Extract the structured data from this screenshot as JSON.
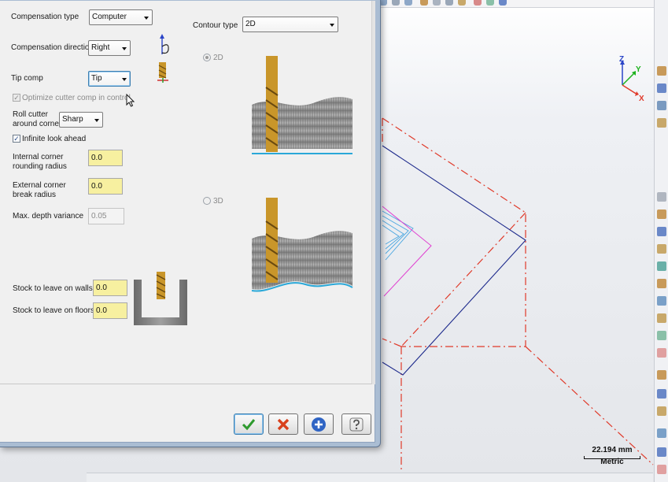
{
  "dialog": {
    "compensation_type": {
      "label": "Compensation type",
      "value": "Computer"
    },
    "compensation_direction": {
      "label": "Compensation direction",
      "value": "Right"
    },
    "tip_comp": {
      "label": "Tip comp",
      "value": "Tip"
    },
    "optimize_cutter_comp": {
      "label": "Optimize cutter comp in control",
      "checked": true,
      "enabled": false
    },
    "roll_cutter": {
      "label_line1": "Roll cutter",
      "label_line2": "around corners",
      "value": "Sharp"
    },
    "infinite_look_ahead": {
      "label": "Infinite look ahead",
      "checked": true
    },
    "internal_corner": {
      "label_line1": "Internal corner",
      "label_line2": "rounding radius",
      "value": "0.0"
    },
    "external_corner": {
      "label_line1": "External corner",
      "label_line2": "break radius",
      "value": "0.0"
    },
    "max_depth_variance": {
      "label": "Max. depth variance",
      "value": "0.05"
    },
    "stock_walls": {
      "label": "Stock to leave on walls",
      "value": "0.0"
    },
    "stock_floors": {
      "label": "Stock to leave on floors",
      "value": "0.0"
    },
    "contour_type": {
      "label": "Contour type",
      "value": "2D"
    },
    "option_2d": {
      "label": "2D",
      "selected": true
    },
    "option_3d": {
      "label": "3D",
      "selected": false
    },
    "buttons": {
      "ok": {
        "icon": "checkmark-icon",
        "color": "#2e9a2e"
      },
      "cancel": {
        "icon": "x-icon",
        "color": "#d8401c"
      },
      "apply": {
        "icon": "plus-circle-icon",
        "color": "#2f64c4"
      },
      "help": {
        "icon": "question-icon",
        "color": "#555555"
      }
    }
  },
  "viewport": {
    "scale_value": "22.194 mm",
    "scale_unit": "Metric",
    "axis_labels": {
      "x": "X",
      "y": "Y",
      "z": "Z"
    },
    "colors": {
      "wire_blue": "#1d2a8c",
      "stock_red": "#e03a2a",
      "toolpath_cyan": "#4aa6e0",
      "toolpath_magenta": "#e040d0"
    }
  }
}
